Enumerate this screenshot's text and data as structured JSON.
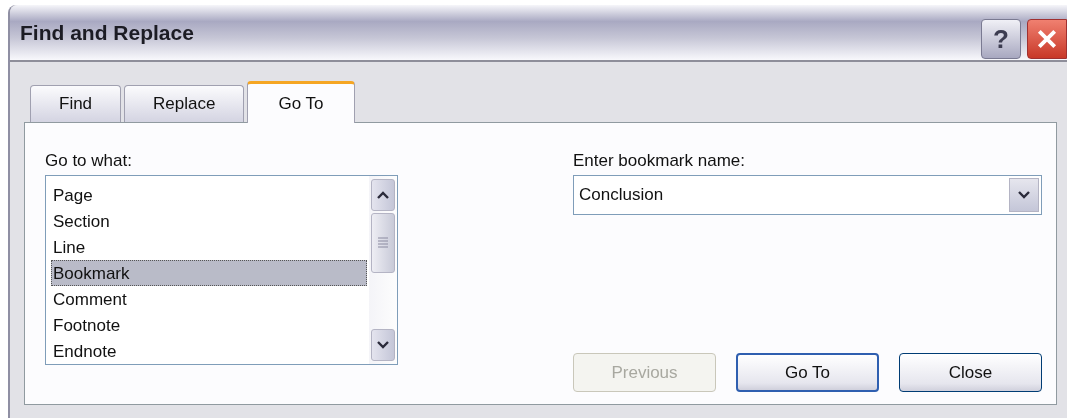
{
  "window": {
    "title": "Find and Replace"
  },
  "help_button": {
    "label": "?"
  },
  "tabs": [
    {
      "label": "Find",
      "selected": false
    },
    {
      "label": "Replace",
      "selected": false
    },
    {
      "label": "Go To",
      "selected": true
    }
  ],
  "goto_what": {
    "label": "Go to what:",
    "items": [
      {
        "label": "Page",
        "selected": false
      },
      {
        "label": "Section",
        "selected": false
      },
      {
        "label": "Line",
        "selected": false
      },
      {
        "label": "Bookmark",
        "selected": true
      },
      {
        "label": "Comment",
        "selected": false
      },
      {
        "label": "Footnote",
        "selected": false
      },
      {
        "label": "Endnote",
        "selected": false
      }
    ]
  },
  "bookmark": {
    "label": "Enter bookmark name:",
    "value": "Conclusion"
  },
  "buttons": [
    {
      "label": "Previous",
      "disabled": true,
      "default": false
    },
    {
      "label": "Go To",
      "disabled": false,
      "default": true
    },
    {
      "label": "Close",
      "disabled": false,
      "default": false
    }
  ]
}
